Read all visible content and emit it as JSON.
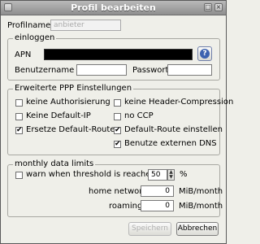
{
  "window": {
    "title": "Profil bearbeiten",
    "close_glyph": "×",
    "restore_glyph": "□"
  },
  "profile": {
    "label": "Profilname:",
    "value": "anbieter"
  },
  "login": {
    "legend": "einloggen",
    "apn_label": "APN",
    "user_label": "Benutzername",
    "password_label": "Passwort",
    "lookup_icon": "help-icon",
    "lookup_glyph": "?"
  },
  "ppp": {
    "legend": "Erweiterte PPP Einstellungen",
    "options": [
      {
        "label": "keine Authorisierung",
        "checked": false
      },
      {
        "label": "keine Header-Compression",
        "checked": false
      },
      {
        "label": "Keine Default-IP",
        "checked": false
      },
      {
        "label": "no CCP",
        "checked": false
      },
      {
        "label": "Ersetze Default-Route",
        "checked": true
      },
      {
        "label": "Default-Route einstellen",
        "checked": true
      },
      {
        "label": "Benutze externen DNS",
        "checked": true
      }
    ]
  },
  "limits": {
    "legend": "monthly data limits",
    "warn_label": "warn when threshold is reached:",
    "warn_checked": false,
    "threshold_value": "50",
    "threshold_unit": "%",
    "home_label": "home network:",
    "home_value": "0",
    "home_unit": "MiB/month",
    "roaming_label": "roaming:",
    "roaming_value": "0",
    "roaming_unit": "MiB/month"
  },
  "buttons": {
    "save": "Speichern",
    "cancel": "Abbrechen"
  },
  "check_glyph": "✔"
}
